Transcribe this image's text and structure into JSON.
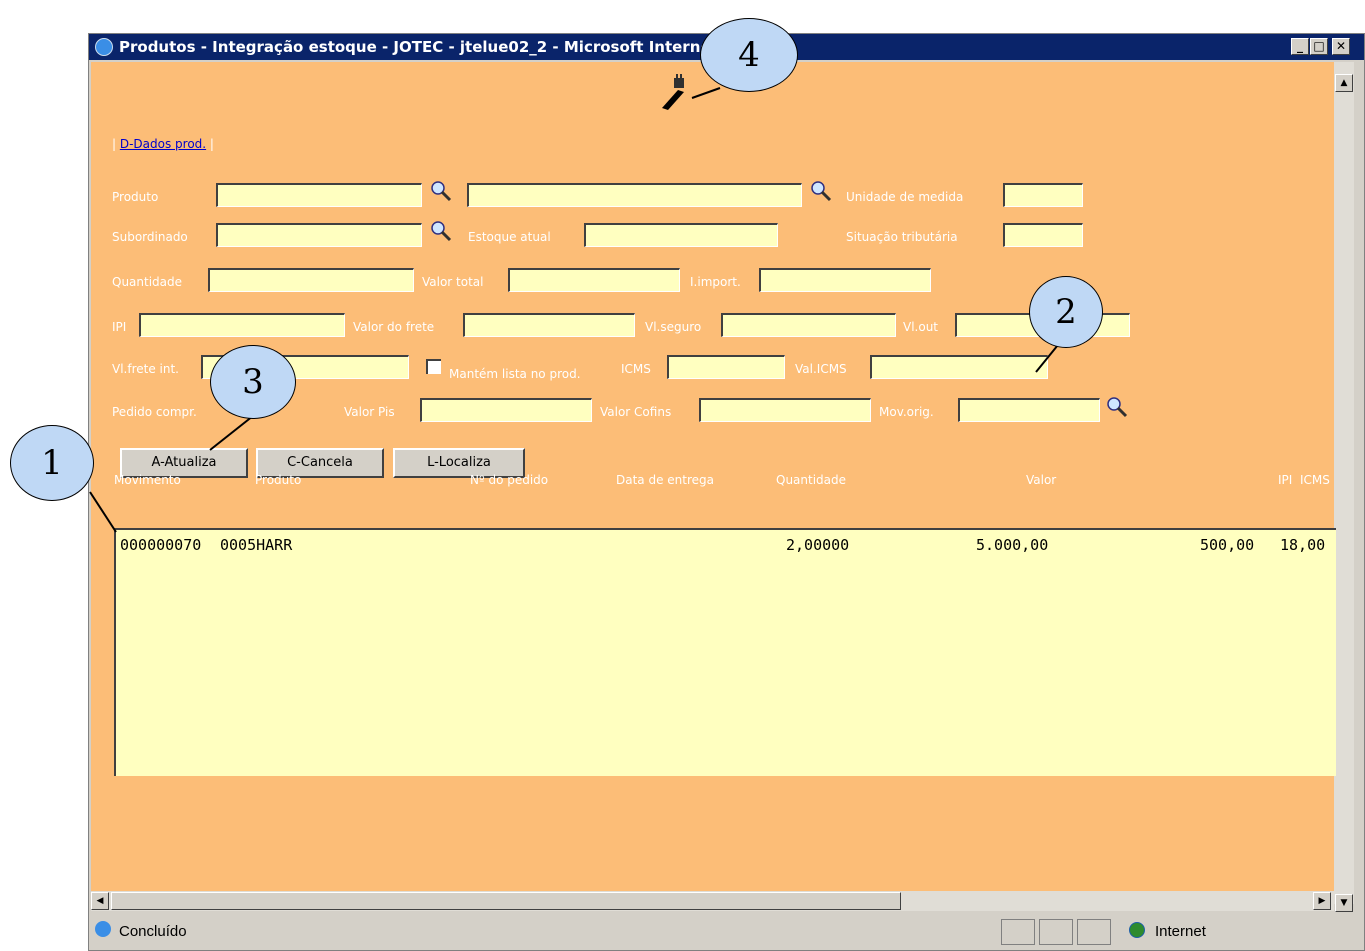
{
  "window": {
    "title": "Produtos - Integração estoque - JOTEC - jtelue02_2 - Microsoft Internet Explorer"
  },
  "tabs_link": {
    "prefix": "| ",
    "label": "D-Dados prod.",
    "suffix": " |"
  },
  "form": {
    "produto_label": "Produto",
    "unidade_label": "Unidade de medida",
    "subordinado_label": "Subordinado",
    "estoque_label": "Estoque atual",
    "situacao_label": "Situação tributária",
    "quantidade_label": "Quantidade",
    "valor_total_label": "Valor total",
    "i_import_label": "I.import.",
    "ipi_label": "IPI",
    "valor_frete_label": "Valor do frete",
    "vl_seguro_label": "Vl.seguro",
    "vl_out_label": "Vl.out",
    "vl_frete_int_label": "Vl.frete int.",
    "mantem_label": "Mantém lista no prod.",
    "icms_label": "ICMS",
    "val_icms_label": "Val.ICMS",
    "pedido_compra_label": "Pedido compr.",
    "valor_pis_label": "Valor Pis",
    "valor_cofins_label": "Valor Cofins",
    "mov_orig_label": "Mov.orig."
  },
  "buttons": {
    "atualiza": "A-Atualiza",
    "cancela": "C-Cancela",
    "localiza": "L-Localiza"
  },
  "table": {
    "headers": [
      "Movimento",
      "Produto",
      "Nº do pedido",
      "Data de entrega",
      "Quantidade",
      "Valor",
      "IPI",
      "ICMS"
    ],
    "rows": [
      {
        "movimento": "000000070",
        "produto": "0005HARR",
        "pedido": "",
        "data": "",
        "quantidade": "2,00000",
        "valor": "5.000,00",
        "ipi": "500,00",
        "icms": "18,00"
      }
    ]
  },
  "status": {
    "text": "Concluído",
    "zone": "Internet"
  },
  "callouts": [
    "1",
    "2",
    "3",
    "4"
  ],
  "icons": {
    "lookup": "magnifier-icon",
    "plug": "plug-icon",
    "ie": "ie-icon"
  }
}
